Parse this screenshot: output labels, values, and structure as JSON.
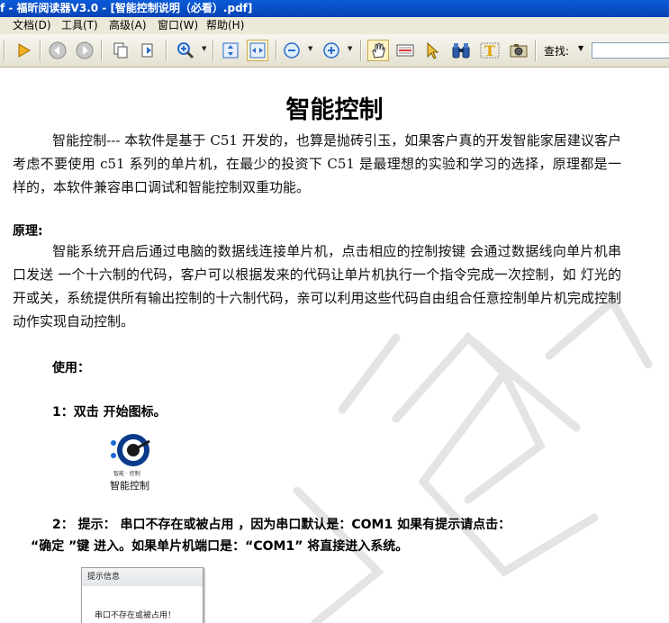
{
  "window": {
    "title": "f - 福昕阅读器V3.0 - [智能控制说明（必看）.pdf]"
  },
  "menu": {
    "items": [
      "文档(D)",
      "工具(T)",
      "高级(A)",
      "窗口(W)",
      "帮助(H)"
    ]
  },
  "toolbar": {
    "find_label": "查找:",
    "find_value": ""
  },
  "document": {
    "title": "智能控制",
    "intro": "智能控制---  本软件是基于 C51 开发的，也算是抛砖引玉，如果客户真的开发智能家居建议客户考虑不要使用 c51 系列的单片机，在最少的投资下 C51 是最理想的实验和学习的选择，原理都是一样的，本软件兼容串口调试和智能控制双重功能。",
    "principle_heading": "原理:",
    "principle_text": "智能系统开启后通过电脑的数据线连接单片机，点击相应的控制按键  会通过数据线向单片机串口发送  一个十六制的代码，客户可以根据发来的代码让单片机执行一个指令完成一次控制，如   灯光的开或关，系统提供所有输出控制的十六制代码，亲可以利用这些代码自由组合任意控制单片机完成控制动作实现自动控制。",
    "usage_heading": "使用：",
    "step1": "1：双击  开始图标。",
    "icon_caption": "智能控制",
    "step2_line1": "2：  提示：    串口不存在或被占用  ，因为串口默认是：COM1    如果有提示请点击：",
    "step2_line2": "“确定  ”键  进入。如果单片机端口是：“COM1”  将直接进入系统。",
    "dialog": {
      "title": "提示信息",
      "message": "串口不存在或被占用！"
    }
  },
  "icons": [
    "play-icon",
    "back-icon",
    "forward-icon",
    "copy-page-icon",
    "page-nav-icon",
    "zoom-in-icon",
    "fit-page-icon",
    "fit-width-icon",
    "zoom-out-minus-icon",
    "zoom-in-plus-icon",
    "hand-tool-icon",
    "text-select-icon",
    "pointer-icon",
    "binoculars-icon",
    "typewriter-icon",
    "snapshot-icon"
  ]
}
